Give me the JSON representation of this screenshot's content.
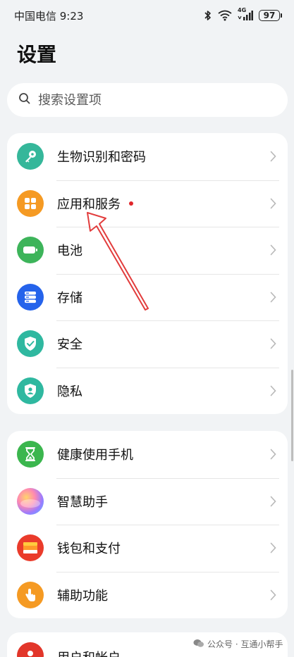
{
  "status": {
    "carrier_time": "中国电信 9:23",
    "network": "4G",
    "battery": "97"
  },
  "page_title": "设置",
  "search": {
    "placeholder": "搜索设置项"
  },
  "group1": [
    {
      "label": "生物识别和密码",
      "icon": "key-icon",
      "color": "#35b79a"
    },
    {
      "label": "应用和服务",
      "icon": "apps-grid-icon",
      "color": "#f59a23",
      "badge": true
    },
    {
      "label": "电池",
      "icon": "battery-icon",
      "color": "#3db45a"
    },
    {
      "label": "存储",
      "icon": "storage-icon",
      "color": "#2563eb"
    },
    {
      "label": "安全",
      "icon": "shield-check-icon",
      "color": "#2fb8a0"
    },
    {
      "label": "隐私",
      "icon": "privacy-shield-icon",
      "color": "#2fb8a0"
    }
  ],
  "group2": [
    {
      "label": "健康使用手机",
      "icon": "hourglass-icon",
      "color": "#3bb64e"
    },
    {
      "label": "智慧助手",
      "icon": "assistant-orb-icon",
      "color": "#8e7cf0"
    },
    {
      "label": "钱包和支付",
      "icon": "wallet-icon",
      "color": "#ea3b2b"
    },
    {
      "label": "辅助功能",
      "icon": "hand-touch-icon",
      "color": "#f59a23"
    }
  ],
  "group3": [
    {
      "label": "用户和帐户",
      "icon": "user-icon",
      "color": "#e2362a"
    }
  ],
  "watermark": "公众号 · 互通小帮手"
}
